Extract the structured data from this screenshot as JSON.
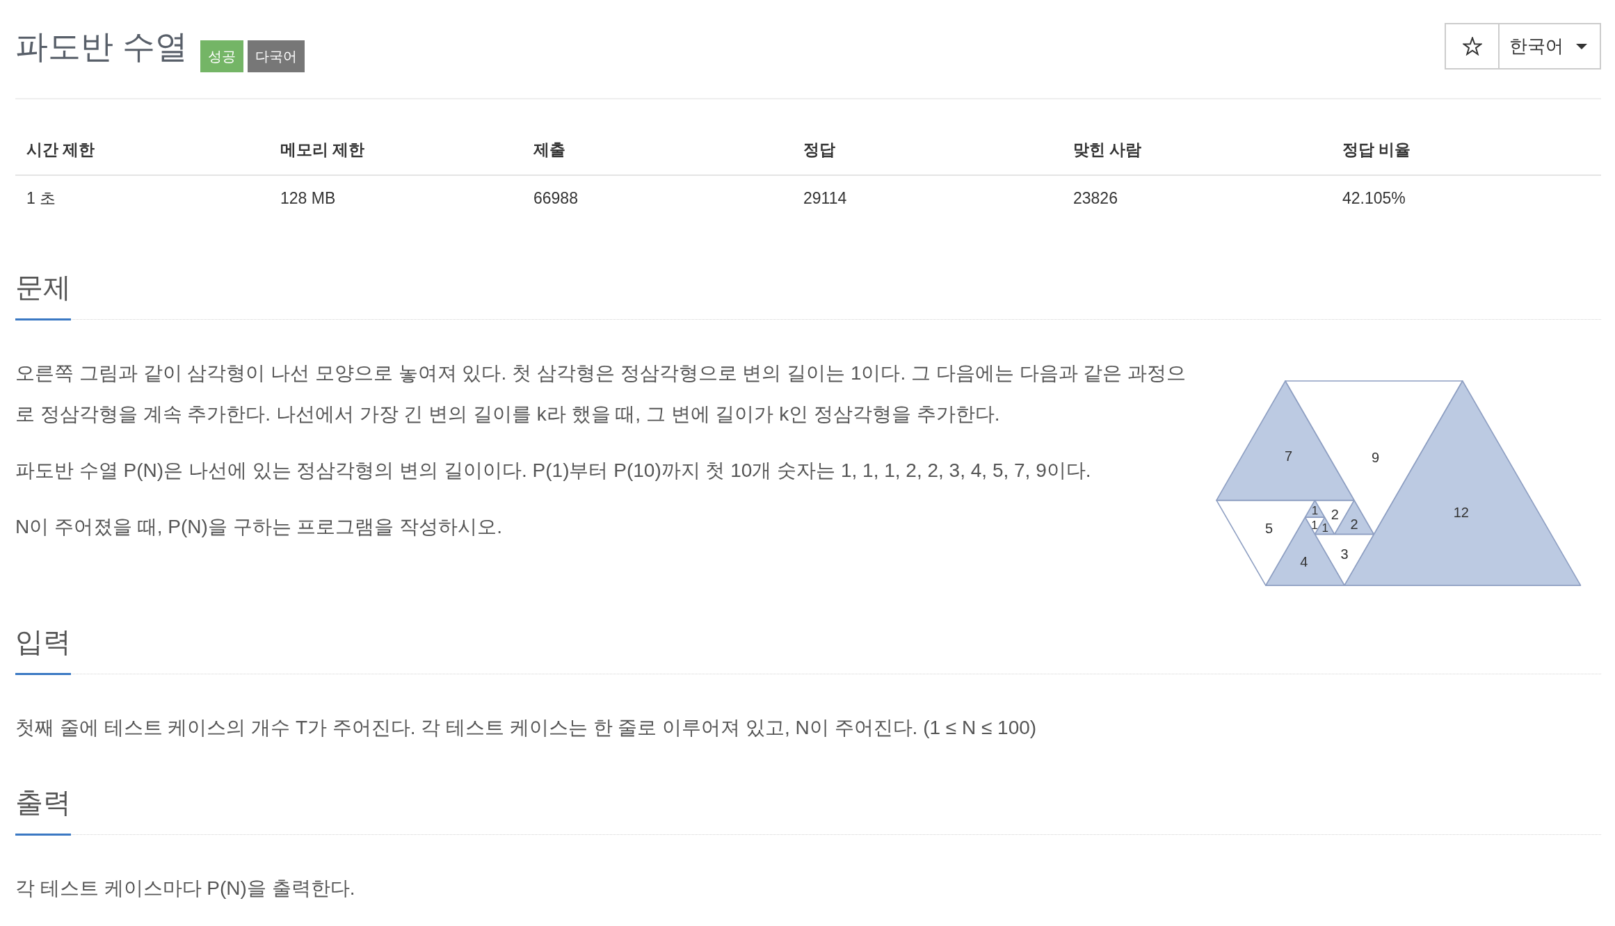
{
  "header": {
    "title": "파도반 수열",
    "labels": [
      {
        "text": "성공",
        "kind": "success"
      },
      {
        "text": "다국어",
        "kind": "language"
      }
    ],
    "favorite": false,
    "language": "한국어"
  },
  "info_table": {
    "columns": [
      "시간 제한",
      "메모리 제한",
      "제출",
      "정답",
      "맞힌 사람",
      "정답 비율"
    ],
    "rows": [
      [
        "1 초",
        "128 MB",
        "66988",
        "29114",
        "23826",
        "42.105%"
      ]
    ]
  },
  "sections": [
    {
      "title": "문제",
      "paragraphs": [
        "오른쪽 그림과 같이 삼각형이 나선 모양으로 놓여져 있다. 첫 삼각형은 정삼각형으로 변의 길이는 1이다. 그 다음에는 다음과 같은 과정으로 정삼각형을 계속 추가한다. 나선에서 가장 긴 변의 길이를 k라 했을 때, 그 변에 길이가 k인 정삼각형을 추가한다.",
        "파도반 수열 P(N)은 나선에 있는 정삼각형의 변의 길이이다. P(1)부터 P(10)까지 첫 10개 숫자는 1, 1, 1, 2, 2, 3, 4, 5, 7, 9이다.",
        "N이 주어졌을 때, P(N)을 구하는 프로그램을 작성하시오."
      ],
      "figure": {
        "triangles": [
          {
            "label": "1",
            "shaded": true
          },
          {
            "label": "1",
            "shaded": false
          },
          {
            "label": "1",
            "shaded": true
          },
          {
            "label": "2",
            "shaded": false
          },
          {
            "label": "2",
            "shaded": true
          },
          {
            "label": "3",
            "shaded": false
          },
          {
            "label": "4",
            "shaded": true
          },
          {
            "label": "5",
            "shaded": false
          },
          {
            "label": "7",
            "shaded": true
          },
          {
            "label": "9",
            "shaded": false
          },
          {
            "label": "12",
            "shaded": true
          }
        ]
      }
    },
    {
      "title": "입력",
      "paragraphs": [
        "첫째 줄에 테스트 케이스의 개수 T가 주어진다. 각 테스트 케이스는 한 줄로 이루어져 있고, N이 주어진다. (1 ≤ N ≤ 100)"
      ]
    },
    {
      "title": "출력",
      "paragraphs": [
        "각 테스트 케이스마다 P(N)을 출력한다."
      ]
    }
  ]
}
